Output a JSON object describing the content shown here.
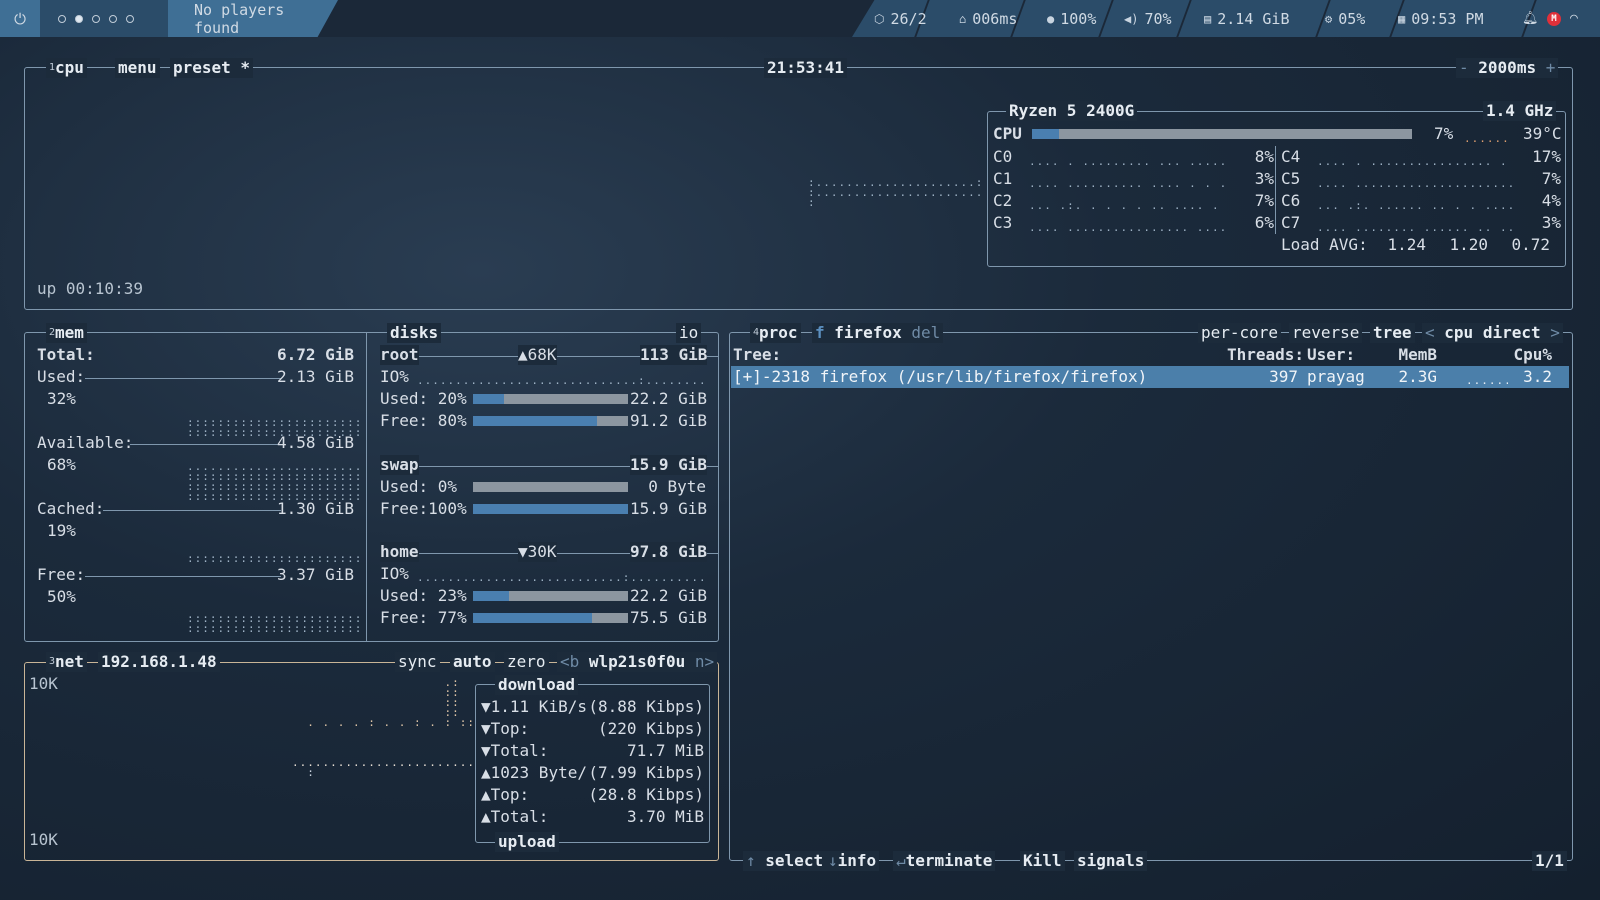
{
  "topbar": {
    "media": "No players found",
    "updates": "26/2",
    "ping": "006ms",
    "mic": "100%",
    "volume": "70%",
    "memory": "2.14 GiB",
    "cpu": "05%",
    "clock": "09:53 PM"
  },
  "cpu_box": {
    "num": "1",
    "title": "cpu",
    "menu": "menu",
    "preset": "preset *",
    "time": "21:53:41",
    "interval": "2000ms",
    "minus": "-",
    "plus": "+",
    "uptime": "up 00:10:39",
    "model": "Ryzen 5 2400G",
    "freq": "1.4 GHz",
    "cpu_label": "CPU",
    "cpu_pct": "7%",
    "cpu_pct_value": 7,
    "temp": "39°C",
    "cores": [
      {
        "name": "C0",
        "pct": "8%"
      },
      {
        "name": "C1",
        "pct": "3%"
      },
      {
        "name": "C2",
        "pct": "7%"
      },
      {
        "name": "C3",
        "pct": "6%"
      },
      {
        "name": "C4",
        "pct": "17%"
      },
      {
        "name": "C5",
        "pct": "7%"
      },
      {
        "name": "C6",
        "pct": "4%"
      },
      {
        "name": "C7",
        "pct": "3%"
      }
    ],
    "load_label": "Load AVG:",
    "load": [
      "1.24",
      "1.20",
      "0.72"
    ]
  },
  "mem_box": {
    "num": "2",
    "title": "mem",
    "total_label": "Total:",
    "total": "6.72 GiB",
    "used_label": "Used:",
    "used": "2.13 GiB",
    "used_pct": "32%",
    "avail_label": "Available:",
    "avail": "4.58 GiB",
    "avail_pct": "68%",
    "cached_label": "Cached:",
    "cached": "1.30 GiB",
    "cached_pct": "19%",
    "free_label": "Free:",
    "free": "3.37 GiB",
    "free_pct": "50%"
  },
  "disks_box": {
    "title": "disks",
    "io": "io",
    "root": {
      "name": "root",
      "io_rate": "68K",
      "size": "113 GiB",
      "io_label": "IO%",
      "used_label": "Used: 20%",
      "used": "22.2 GiB",
      "used_value": 20,
      "free_label": "Free: 80%",
      "free": "91.2 GiB",
      "free_value": 80
    },
    "swap": {
      "name": "swap",
      "size": "15.9 GiB",
      "used_label": "Used:  0%",
      "used": "0 Byte",
      "used_value": 0,
      "free_label": "Free:100%",
      "free": "15.9 GiB",
      "free_value": 100
    },
    "home": {
      "name": "home",
      "io_rate": "30K",
      "size": "97.8 GiB",
      "io_label": "IO%",
      "used_label": "Used: 23%",
      "used": "22.2 GiB",
      "used_value": 23,
      "free_label": "Free: 77%",
      "free": "75.5 GiB",
      "free_value": 77
    }
  },
  "net_box": {
    "num": "3",
    "title": "net",
    "ip": "192.168.1.48",
    "sync": "sync",
    "auto": "auto",
    "zero": "zero",
    "iface_prev": "<b",
    "iface": "wlp21s0f0u",
    "iface_next": "n>",
    "scale_top": "10K",
    "scale_bottom": "10K",
    "download_label": "download",
    "upload_label": "upload",
    "dl_rate": "1.11 KiB/s",
    "dl_rate_bits": "(8.88 Kibps)",
    "dl_top_label": "Top:",
    "dl_top": "(220 Kibps)",
    "dl_total_label": "Total:",
    "dl_total": "71.7 MiB",
    "ul_rate": "1023 Byte/",
    "ul_rate_bits": "(7.99 Kibps)",
    "ul_top_label": "Top:",
    "ul_top": "(28.8 Kibps)",
    "ul_total_label": "Total:",
    "ul_total": "3.70 MiB"
  },
  "proc_box": {
    "num": "4",
    "title": "proc",
    "filter_key": "f",
    "filter": "firefox",
    "del": "del",
    "per_core": "per-core",
    "reverse": "reverse",
    "tree": "tree",
    "sort_prev": "<",
    "sort": "cpu direct",
    "sort_next": ">",
    "headers": {
      "tree": "Tree:",
      "threads": "Threads:",
      "user": "User:",
      "mem": "MemB",
      "cpu": "Cpu%"
    },
    "rows": [
      {
        "name": "[+]-2318 firefox (/usr/lib/firefox/firefox)",
        "threads": "397",
        "user": "prayag",
        "mem": "2.3G",
        "cpu": "3.2"
      }
    ],
    "footer": {
      "select": "select",
      "info": "info",
      "terminate": "terminate",
      "kill": "Kill",
      "signals": "signals",
      "page": "1/1"
    }
  }
}
